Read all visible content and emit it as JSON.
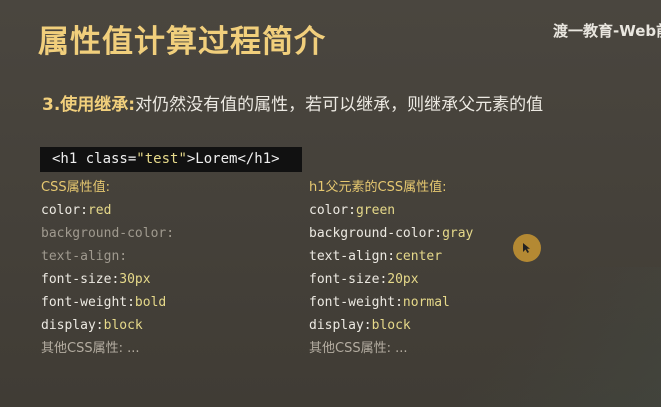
{
  "slide": {
    "title": "属性值计算过程简介",
    "watermark": "渡一教育-Web前",
    "subtitle_accent": "3.使用继承:",
    "subtitle_rest": "对仍然没有值的属性，若可以继承，则继承父元素的值"
  },
  "code": {
    "open_tag": "<h1 class=",
    "attr_value": "\"test\"",
    "tail": ">Lorem</h1>"
  },
  "left_column": {
    "heading": "CSS属性值:",
    "rows": [
      {
        "prop": "color:",
        "val": "red"
      },
      {
        "prop": "background-color:",
        "val": ""
      },
      {
        "prop": "text-align:",
        "val": ""
      },
      {
        "prop": "font-size:",
        "val": "30px"
      },
      {
        "prop": "font-weight:",
        "val": "bold"
      },
      {
        "prop": "display:",
        "val": "block"
      }
    ],
    "other": "其他CSS属性: ..."
  },
  "right_column": {
    "heading": "h1父元素的CSS属性值:",
    "rows": [
      {
        "prop": "color:",
        "val": "green"
      },
      {
        "prop": "background-color:",
        "val": "gray"
      },
      {
        "prop": "text-align:",
        "val": "center"
      },
      {
        "prop": "font-size:",
        "val": "20px"
      },
      {
        "prop": "font-weight:",
        "val": "normal"
      },
      {
        "prop": "display:",
        "val": "block"
      }
    ],
    "other": "其他CSS属性: ..."
  },
  "colors": {
    "title": "#f1cf7c",
    "value": "#e6d98a",
    "background": "#47433c"
  }
}
